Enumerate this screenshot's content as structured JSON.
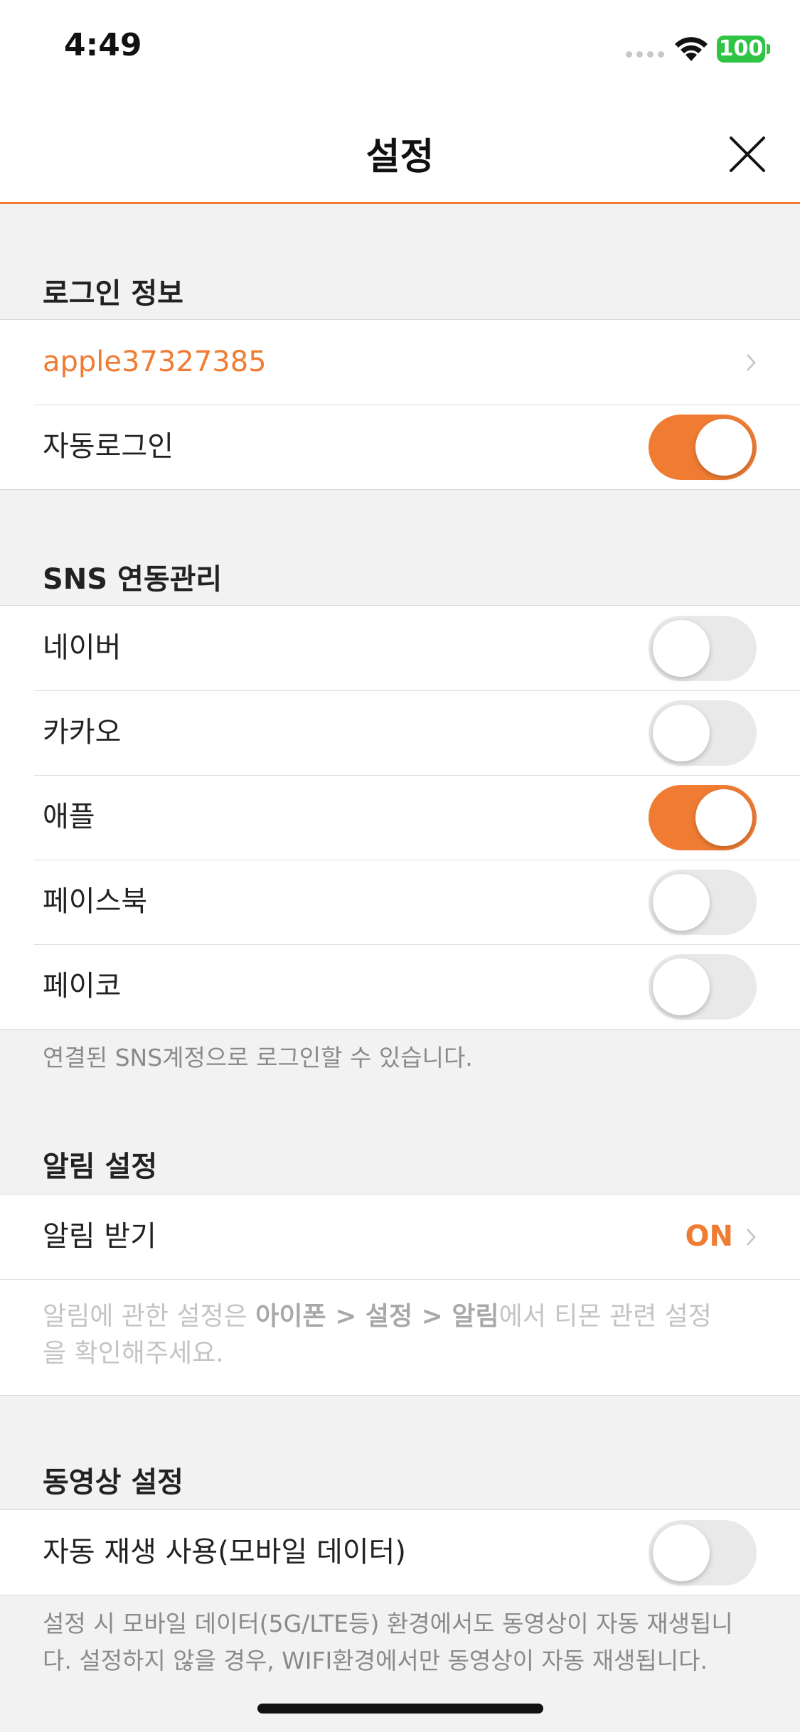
{
  "status": {
    "time": "4:49",
    "battery": "100"
  },
  "nav": {
    "title": "설정"
  },
  "login": {
    "header": "로그인 정보",
    "account_id": "apple37327385",
    "auto_login_label": "자동로그인",
    "auto_login_on": true
  },
  "sns": {
    "header": "SNS 연동관리",
    "items": [
      {
        "label": "네이버",
        "on": false
      },
      {
        "label": "카카오",
        "on": false
      },
      {
        "label": "애플",
        "on": true
      },
      {
        "label": "페이스북",
        "on": false
      },
      {
        "label": "페이코",
        "on": false
      }
    ],
    "note": "연결된 SNS계정으로 로그인할 수 있습니다."
  },
  "notification": {
    "header": "알림 설정",
    "receive_label": "알림 받기",
    "receive_value": "ON",
    "note_prefix": "알림에 관한 설정은 ",
    "note_path": "아이폰 > 설정 > 알림",
    "note_suffix": "에서 티몬 관련 설정을 확인해주세요."
  },
  "video": {
    "header": "동영상 설정",
    "autoplay_label": "자동 재생 사용(모바일 데이터)",
    "autoplay_on": false,
    "note": "설정 시 모바일 데이터(5G/LTE등) 환경에서도 동영상이 자동 재생됩니다. 설정하지 않을 경우, WIFI환경에서만 동영상이 자동 재생됩니다."
  },
  "colors": {
    "accent": "#f07c33",
    "toggle_off": "#e9e9ea",
    "background": "#f2f2f2"
  }
}
